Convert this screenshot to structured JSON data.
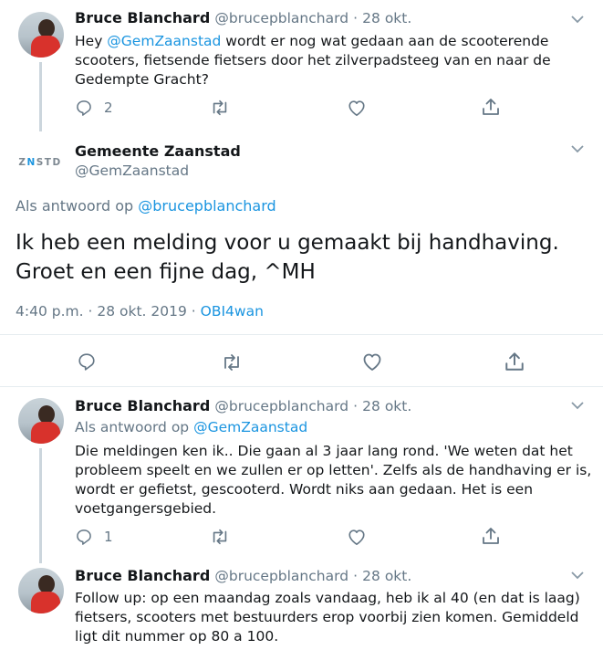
{
  "tweet1": {
    "name": "Bruce Blanchard",
    "handle": "@brucepblanchard",
    "sep": "·",
    "date": "28 okt.",
    "text_prefix": "Hey ",
    "mention": "@GemZaanstad",
    "text_rest_1": " wordt er nog wat gedaan aan de scooterende",
    "text_line_2": "scooters, fietsende fietsers door het zilverpadsteeg van en naar de",
    "text_line_3": "Gedempte Gracht?",
    "reply_count": "2"
  },
  "main": {
    "logo_left": "Z",
    "logo_mid": "N",
    "logo_right": "STD",
    "name": "Gemeente Zaanstad",
    "handle": "@GemZaanstad",
    "reply_to_prefix": "Als antwoord op ",
    "reply_to_handle": "@brucepblanchard",
    "text_line_1": "Ik heb een melding voor u gemaakt bij handhaving.",
    "text_line_2": "Groet en een fijne dag, ^MH",
    "time": "4:40 p.m.",
    "sep1": "·",
    "date": "28 okt. 2019",
    "sep2": "·",
    "source": "OBI4wan"
  },
  "tweet2": {
    "name": "Bruce Blanchard",
    "handle": "@brucepblanchard",
    "sep": "·",
    "date": "28 okt.",
    "reply_to_prefix": "Als antwoord op ",
    "reply_to_handle": "@GemZaanstad",
    "text_lines": [
      "Die meldingen ken ik.. Die gaan al 3 jaar lang rond. 'We weten dat het",
      "probleem speelt en we zullen er op letten'. Zelfs als de handhaving er is,",
      "wordt er gefietst, gescooterd. Wordt niks aan gedaan. Het is een",
      "voetgangersgebied."
    ],
    "reply_count": "1"
  },
  "tweet3": {
    "name": "Bruce Blanchard",
    "handle": "@brucepblanchard",
    "sep": "·",
    "date": "28 okt.",
    "text_lines": [
      "Follow up: op een maandag zoals vandaag, heb ik al 40 (en dat is laag)",
      "fietsers, scooters met bestuurders erop voorbij zien komen. Gemiddeld",
      "ligt dit nummer op 80 a 100."
    ]
  },
  "icons": {
    "reply": "reply-icon",
    "retweet": "retweet-icon",
    "like": "heart-icon",
    "share": "share-icon",
    "more": "chevron-down-icon"
  },
  "colors": {
    "link": "#1b95e0",
    "muted": "#657786",
    "text": "#14171a",
    "divider": "#e6ecf0",
    "thread": "#ccd6dd"
  }
}
